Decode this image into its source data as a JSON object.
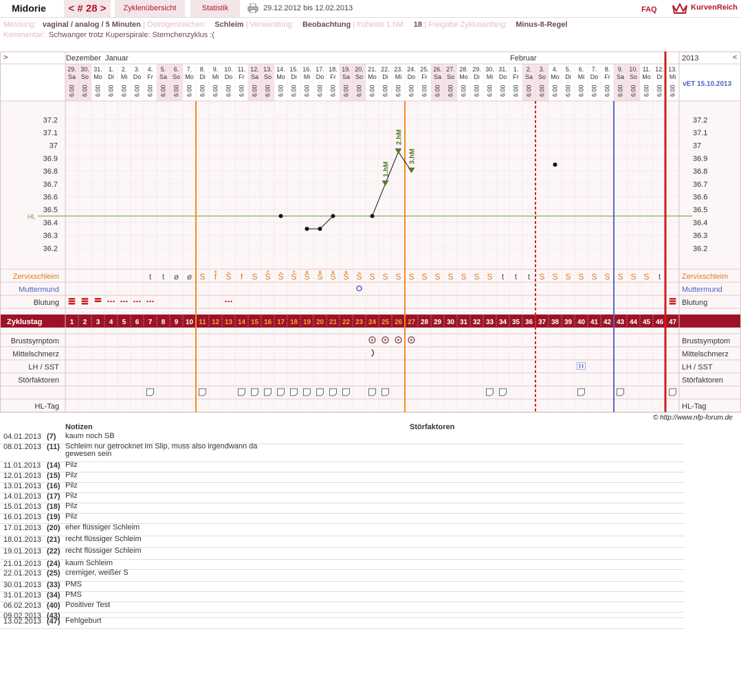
{
  "header": {
    "user": "Midorie",
    "cycle_tab": "< # 28 >",
    "overview_tab": "Zyklenübersicht",
    "stats_tab": "Statistik",
    "date_range": "29.12.2012 bis 12.02.2013",
    "faq": "FAQ",
    "brand": "KurvenReich"
  },
  "info": {
    "messung_label": "Messung:",
    "messung": "vaginal / analog / 5 Minuten",
    "oestrogen_label": "Östrogenzeichen:",
    "oestrogen": "Schleim",
    "verwendung_label": "Verwendung:",
    "verwendung": "Beobachtung",
    "hm_label": "früheste 1.hM:",
    "hm": "18",
    "freigabe_label": "Freigabe Zyklusanfang:",
    "freigabe": "Minus-8-Regel",
    "kommentar_label": "Kommentar:",
    "kommentar": "Schwanger trotz Kuperspirale: Sternchenzyklus :("
  },
  "chart_nav": {
    "prev": ">",
    "next": "<",
    "year": "2013",
    "vet": "vET 15.10.2013"
  },
  "months": [
    {
      "label": "Dezember",
      "day_index": 0
    },
    {
      "label": "Januar",
      "day_index": 3
    },
    {
      "label": "Februar",
      "day_index": 34
    }
  ],
  "days": [
    {
      "d": "29.",
      "w": "Sa",
      "t": "6:00",
      "we": true
    },
    {
      "d": "30.",
      "w": "So",
      "t": "6:00",
      "we": true
    },
    {
      "d": "31.",
      "w": "Mo",
      "t": "6:00",
      "we": false
    },
    {
      "d": "1.",
      "w": "Di",
      "t": "6:00",
      "we": false
    },
    {
      "d": "2.",
      "w": "Mi",
      "t": "6:00",
      "we": false
    },
    {
      "d": "3.",
      "w": "Do",
      "t": "6:00",
      "we": false
    },
    {
      "d": "4.",
      "w": "Fr",
      "t": "6:00",
      "we": false
    },
    {
      "d": "5.",
      "w": "Sa",
      "t": "6:00",
      "we": true
    },
    {
      "d": "6.",
      "w": "So",
      "t": "6:00",
      "we": true
    },
    {
      "d": "7.",
      "w": "Mo",
      "t": "6:00",
      "we": false
    },
    {
      "d": "8.",
      "w": "Di",
      "t": "6:00",
      "we": false
    },
    {
      "d": "9.",
      "w": "Mi",
      "t": "6:00",
      "we": false
    },
    {
      "d": "10.",
      "w": "Do",
      "t": "6:00",
      "we": false
    },
    {
      "d": "11.",
      "w": "Fr",
      "t": "6:00",
      "we": false
    },
    {
      "d": "12.",
      "w": "Sa",
      "t": "6:00",
      "we": true
    },
    {
      "d": "13.",
      "w": "So",
      "t": "6:00",
      "we": true
    },
    {
      "d": "14.",
      "w": "Mo",
      "t": "6:00",
      "we": false
    },
    {
      "d": "15.",
      "w": "Di",
      "t": "6:00",
      "we": false
    },
    {
      "d": "16.",
      "w": "Mi",
      "t": "6:00",
      "we": false
    },
    {
      "d": "17.",
      "w": "Do",
      "t": "6:00",
      "we": false
    },
    {
      "d": "18.",
      "w": "Fr",
      "t": "6:00",
      "we": false
    },
    {
      "d": "19.",
      "w": "Sa",
      "t": "6:00",
      "we": true
    },
    {
      "d": "20.",
      "w": "So",
      "t": "6:00",
      "we": true
    },
    {
      "d": "21.",
      "w": "Mo",
      "t": "6:00",
      "we": false
    },
    {
      "d": "22.",
      "w": "Di",
      "t": "6:00",
      "we": false
    },
    {
      "d": "23.",
      "w": "Mi",
      "t": "6:00",
      "we": false
    },
    {
      "d": "24.",
      "w": "Do",
      "t": "6:00",
      "we": false
    },
    {
      "d": "25.",
      "w": "Fr",
      "t": "6:00",
      "we": false
    },
    {
      "d": "26.",
      "w": "Sa",
      "t": "6:00",
      "we": true
    },
    {
      "d": "27.",
      "w": "So",
      "t": "6:00",
      "we": true
    },
    {
      "d": "28.",
      "w": "Mo",
      "t": "6:00",
      "we": false
    },
    {
      "d": "29.",
      "w": "Di",
      "t": "6:00",
      "we": false
    },
    {
      "d": "30.",
      "w": "Mi",
      "t": "6:00",
      "we": false
    },
    {
      "d": "31.",
      "w": "Do",
      "t": "6:00",
      "we": false
    },
    {
      "d": "1.",
      "w": "Fr",
      "t": "6:00",
      "we": false
    },
    {
      "d": "2.",
      "w": "Sa",
      "t": "6:00",
      "we": true
    },
    {
      "d": "3.",
      "w": "So",
      "t": "6:00",
      "we": true
    },
    {
      "d": "4.",
      "w": "Mo",
      "t": "6:00",
      "we": false
    },
    {
      "d": "5.",
      "w": "Di",
      "t": "6:00",
      "we": false
    },
    {
      "d": "6.",
      "w": "Mi",
      "t": "6:00",
      "we": false
    },
    {
      "d": "7.",
      "w": "Do",
      "t": "6:00",
      "we": false
    },
    {
      "d": "8.",
      "w": "Fr",
      "t": "6:00",
      "we": false
    },
    {
      "d": "9.",
      "w": "Sa",
      "t": "6:00",
      "we": true
    },
    {
      "d": "10.",
      "w": "So",
      "t": "6:00",
      "we": true
    },
    {
      "d": "11.",
      "w": "Mo",
      "t": "6:00",
      "we": false
    },
    {
      "d": "12.",
      "w": "Di",
      "t": "6:00",
      "we": false
    },
    {
      "d": "13.",
      "w": "Mi",
      "t": "6:00",
      "we": false
    }
  ],
  "chart_data": {
    "type": "line",
    "y_ticks": [
      37.2,
      37.1,
      37,
      36.9,
      36.8,
      36.7,
      36.6,
      36.5,
      36.4,
      36.3,
      36.2
    ],
    "ylim": [
      36.1,
      37.25
    ],
    "hl_label": "HL",
    "hl_value": 36.45,
    "temperature": [
      null,
      null,
      null,
      null,
      null,
      null,
      null,
      null,
      null,
      null,
      null,
      null,
      null,
      null,
      null,
      null,
      36.45,
      null,
      36.35,
      36.35,
      36.45,
      null,
      null,
      36.45,
      36.7,
      36.95,
      36.8,
      null,
      null,
      null,
      null,
      null,
      null,
      null,
      null,
      null,
      null,
      36.85,
      null,
      null,
      null,
      null,
      null,
      null,
      null,
      null,
      null
    ],
    "hm_markers": [
      {
        "day": 25,
        "label": "1.hM"
      },
      {
        "day": 26,
        "label": "2.hM"
      },
      {
        "day": 27,
        "label": "3.hM"
      }
    ],
    "orange_lines": [
      11,
      27
    ],
    "dashed_red_line": 36,
    "blue_line": 42,
    "red_line": 47
  },
  "rows": {
    "zervix": "Zervixschleim",
    "muttermund": "Muttermund",
    "blutung": "Blutung",
    "zyklustag": "Zyklustag",
    "brust": "Brustsymptom",
    "mittel": "Mittelschmerz",
    "lh": "LH / SST",
    "stoer": "Störfaktoren",
    "notizen": "Notizen",
    "hltag": "HL-Tag"
  },
  "zervix_values": [
    "",
    "",
    "",
    "",
    "",
    "",
    "t",
    "t",
    "ø",
    "ø",
    "S",
    "f",
    "Ŝ",
    "f",
    "S",
    "S",
    "Ŝ",
    "S",
    "Ŝ",
    "Ŝ",
    "Ŝ",
    "Ŝ",
    "Ŝ",
    "S",
    "S",
    "S",
    "S",
    "S",
    "S",
    "S",
    "S",
    "S",
    "S",
    "t",
    "t",
    "t",
    "S",
    "S",
    "S",
    "S",
    "S",
    "S",
    "S",
    "S",
    "S",
    "t",
    ""
  ],
  "zervix_peak": [
    12,
    16,
    18,
    19,
    20,
    21,
    22
  ],
  "blutung": [
    3,
    3,
    2,
    1,
    1,
    1,
    1,
    0,
    0,
    0,
    0,
    0,
    1,
    0,
    0,
    0,
    0,
    0,
    0,
    0,
    0,
    0,
    0,
    0,
    0,
    0,
    0,
    0,
    0,
    0,
    0,
    0,
    0,
    0,
    0,
    0,
    0,
    0,
    0,
    0,
    0,
    0,
    0,
    0,
    0,
    0,
    3
  ],
  "brust_days": [
    24,
    25,
    26,
    27
  ],
  "mittel_days": [
    24
  ],
  "lh_days": [
    40
  ],
  "notiz_days": [
    7,
    11,
    14,
    15,
    16,
    17,
    18,
    19,
    20,
    21,
    22,
    24,
    25,
    33,
    34,
    40,
    43,
    47
  ],
  "copyright": "© http://www.nfp-forum.de",
  "notes": {
    "col_notes": "Notizen",
    "col_stoer": "Störfaktoren",
    "entries": [
      {
        "date": "04.01.2013",
        "day": "(7)",
        "text": "kaum noch SB"
      },
      {
        "date": "08.01.2013",
        "day": "(11)",
        "text": "Schleim nur getrocknet im Slip, muss also irgendwann da gewesen sein"
      },
      {
        "date": "11.01.2013",
        "day": "(14)",
        "text": "Pilz"
      },
      {
        "date": "12.01.2013",
        "day": "(15)",
        "text": "Pilz"
      },
      {
        "date": "13.01.2013",
        "day": "(16)",
        "text": "Pilz"
      },
      {
        "date": "14.01.2013",
        "day": "(17)",
        "text": "Pilz"
      },
      {
        "date": "15.01.2013",
        "day": "(18)",
        "text": "Pilz"
      },
      {
        "date": "16.01.2013",
        "day": "(19)",
        "text": "Pilz"
      },
      {
        "date": "17.01.2013",
        "day": "(20)",
        "text": "eher flüssiger Schleim"
      },
      {
        "date": "18.01.2013",
        "day": "(21)",
        "text": "recht flüssiger Schleim"
      },
      {
        "date": "19.01.2013",
        "day": "(22)",
        "text": "recht flüssiger Schleim"
      },
      {
        "date": "21.01.2013",
        "day": "(24)",
        "text": "kaum Schleim"
      },
      {
        "date": "22.01.2013",
        "day": "(25)",
        "text": "cremiger, weißer S"
      },
      {
        "date": "30.01.2013",
        "day": "(33)",
        "text": "PMS"
      },
      {
        "date": "31.01.2013",
        "day": "(34)",
        "text": "PMS"
      },
      {
        "date": "06.02.2013",
        "day": "(40)",
        "text": "Positiver Test"
      },
      {
        "date": "09.02.2013",
        "day": "(43)",
        "text": ""
      },
      {
        "date": "13.02.2013",
        "day": "(47)",
        "text": "Fehlgeburt"
      }
    ]
  }
}
